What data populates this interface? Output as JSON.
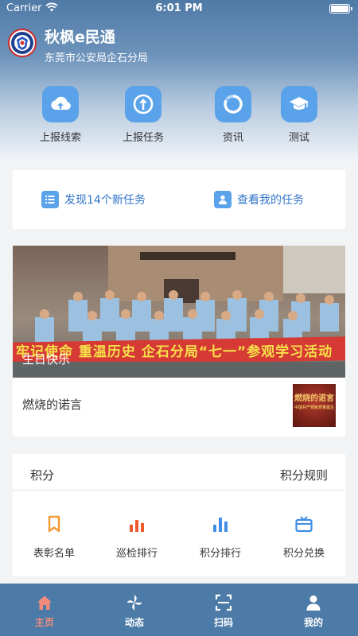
{
  "status": {
    "carrier": "Carrier",
    "time": "6:01 PM"
  },
  "header": {
    "title": "秋枫e民通",
    "subtitle": "东莞市公安局企石分局"
  },
  "quick_actions": [
    {
      "label": "上报线索",
      "icon": "cloud-upload-icon"
    },
    {
      "label": "上报任务",
      "icon": "upload-arrow-icon"
    },
    {
      "label": "资讯",
      "icon": "refresh-circle-icon"
    },
    {
      "label": "测试",
      "icon": "graduation-cap-icon"
    }
  ],
  "tasks": {
    "new_tasks": "发现14个新任务",
    "my_tasks": "查看我的任务"
  },
  "news": {
    "banner_text": "牢记使命 重温历史 企石分局“七一”参观学习活动",
    "banner_caption": "生日快乐",
    "title": "燃烧的诺言",
    "thumb_text": "燃烧的诺言",
    "thumb_subtext": "中国共产党新党章诞生"
  },
  "score": {
    "title": "积分",
    "rules": "积分规则",
    "items": [
      {
        "label": "表彰名单",
        "icon": "bookmark-icon",
        "color": "#f59a32"
      },
      {
        "label": "巡检排行",
        "icon": "bar-chart-icon",
        "color": "#ee5a2c"
      },
      {
        "label": "积分排行",
        "icon": "bar-chart-icon",
        "color": "#3f8ee6"
      },
      {
        "label": "积分兑换",
        "icon": "gift-card-icon",
        "color": "#3f8ee6"
      }
    ]
  },
  "tabs": [
    {
      "label": "主页",
      "icon": "home-icon",
      "active": true
    },
    {
      "label": "动态",
      "icon": "pinwheel-icon",
      "active": false
    },
    {
      "label": "扫码",
      "icon": "scan-icon",
      "active": false
    },
    {
      "label": "我的",
      "icon": "user-icon",
      "active": false
    }
  ],
  "colors": {
    "accent": "#5aa2ea",
    "tabbar": "#4d7ba7",
    "active_tab": "#f08b7e"
  }
}
